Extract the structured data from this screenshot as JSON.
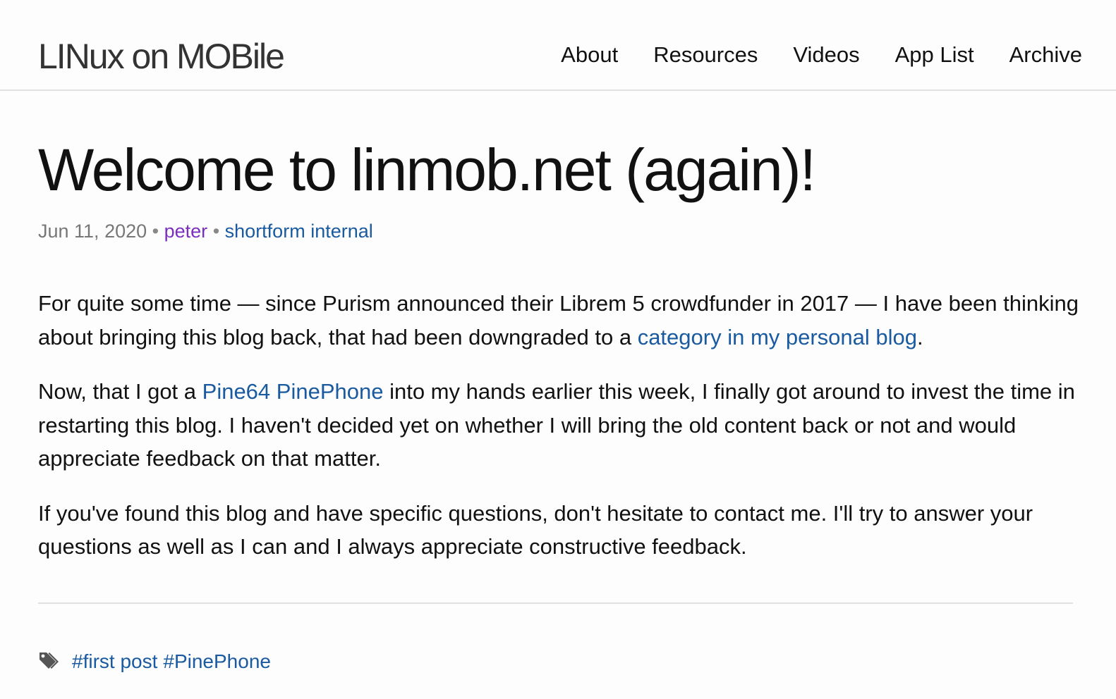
{
  "header": {
    "site_title": "LINux on MOBile",
    "nav": [
      {
        "label": "About"
      },
      {
        "label": "Resources"
      },
      {
        "label": "Videos"
      },
      {
        "label": "App List"
      },
      {
        "label": "Archive"
      }
    ]
  },
  "post": {
    "title": "Welcome to linmob.net (again)!",
    "meta": {
      "date": "Jun 11, 2020",
      "separator": "•",
      "author": "peter",
      "categories": [
        "shortform",
        "internal"
      ]
    },
    "paragraphs": [
      {
        "before": "For quite some time — since Purism announced their Librem 5 crowdfunder in 2017 — I have been thinking about bringing this blog back, that had been downgraded to a ",
        "link": "category in my personal blog",
        "after": "."
      },
      {
        "before": "Now, that I got a ",
        "link": "Pine64 PinePhone",
        "after": " into my hands earlier this week, I finally got around to invest the time in restarting this blog. I haven't decided yet on whether I will bring the old content back or not and would appreciate feedback on that matter."
      },
      {
        "text": "If you've found this blog and have specific questions, don't hesitate to contact me. I'll try to answer your questions as well as I can and I always appreciate constructive feedback."
      }
    ],
    "tags": [
      "#first post",
      "#PinePhone"
    ]
  },
  "colors": {
    "link": "#1a5aa0",
    "author": "#7b2fbf",
    "meta": "#777777",
    "text": "#111111",
    "background": "#fdfdfd",
    "rule": "#e1e1e1"
  },
  "icons": {
    "tags": "tags-icon"
  }
}
